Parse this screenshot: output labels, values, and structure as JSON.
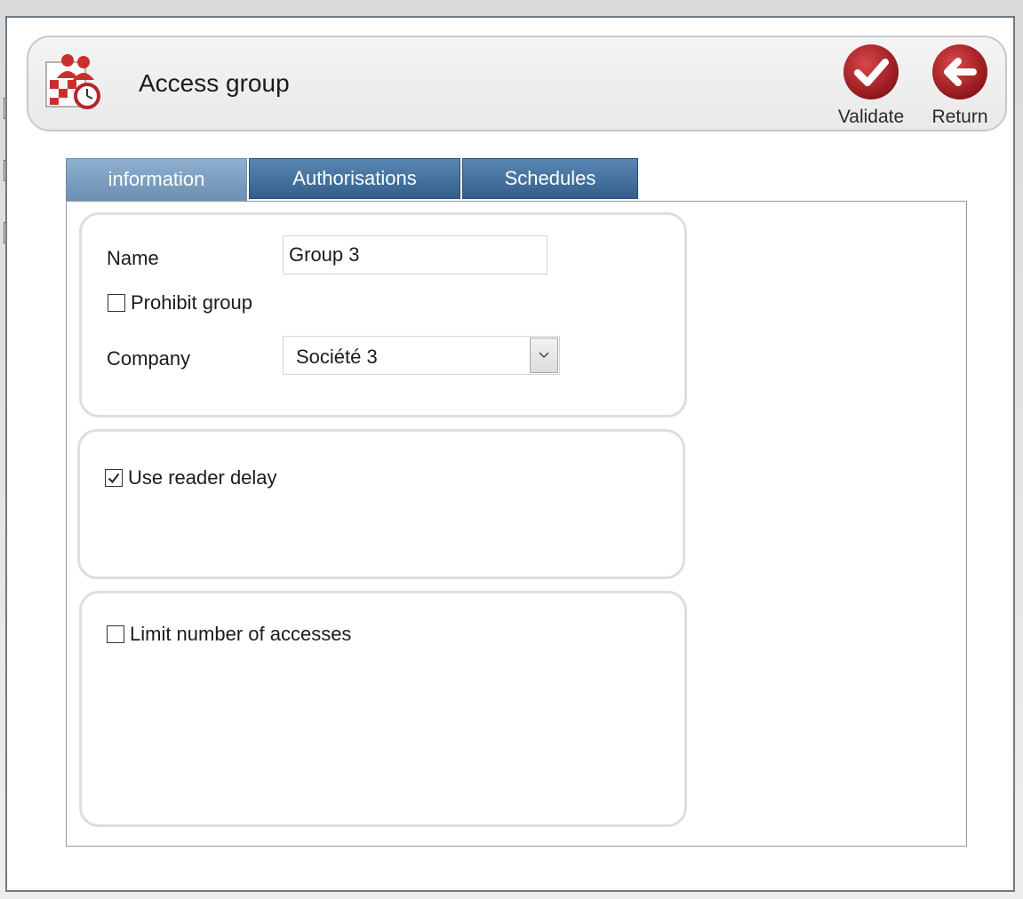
{
  "window": {
    "title": "Access group",
    "icon": "access-group-icon"
  },
  "actions": [
    {
      "label": "Validate",
      "icon": "check-icon",
      "color": "#b5262b"
    },
    {
      "label": "Return",
      "icon": "arrow-left-icon",
      "color": "#b5262b"
    }
  ],
  "tabs": [
    {
      "label": "information",
      "active": true
    },
    {
      "label": "Authorisations",
      "active": false
    },
    {
      "label": "Schedules",
      "active": false
    }
  ],
  "info": {
    "name_label": "Name",
    "name_value": "Group 3",
    "prohibit_label": "Prohibit group",
    "prohibit_checked": false,
    "company_label": "Company",
    "company_value": "Société 3"
  },
  "reader_delay": {
    "label": "Use reader delay",
    "checked": true
  },
  "limit_access": {
    "label": "Limit number of accesses",
    "checked": false
  },
  "colors": {
    "tab_active": "#7e9fc2",
    "tab_inactive": "#446f9c",
    "action_red": "#b5262b"
  }
}
